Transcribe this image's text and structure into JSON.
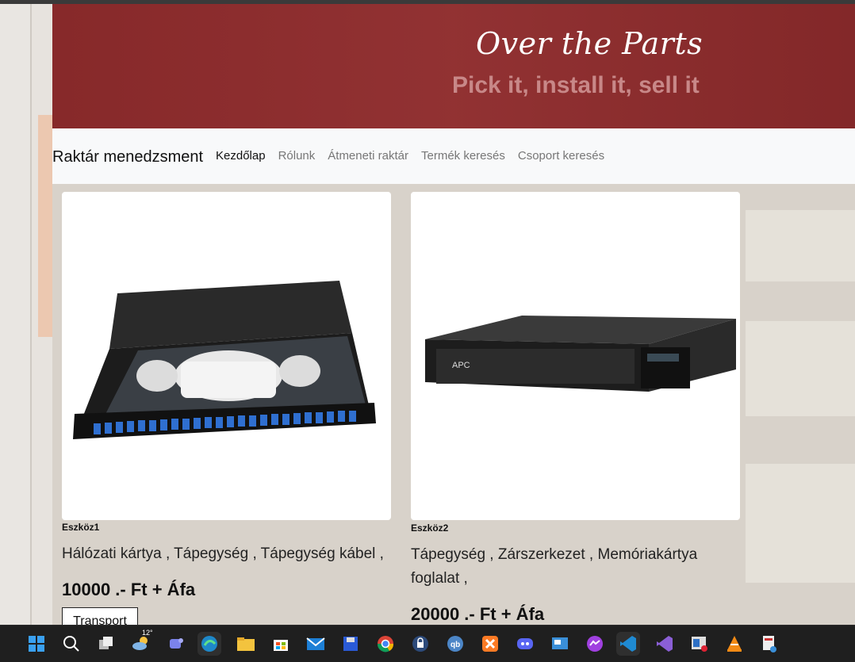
{
  "hero": {
    "title": "Over the Parts",
    "subtitle": "Pick it, install it, sell it"
  },
  "navbar": {
    "brand": "Raktár menedzsment",
    "links": [
      "Kezdőlap",
      "Rólunk",
      "Átmeneti raktár",
      "Termék keresés",
      "Csoport keresés"
    ]
  },
  "products": [
    {
      "name": "Eszköz1",
      "categories": "Hálózati kártya , Tápegység , Tápegység kábel ,",
      "price": "10000 .- Ft + Áfa",
      "button": "Transport",
      "image": "fiber-patch-panel"
    },
    {
      "name": "Eszköz2",
      "categories_line1": "Tápegység , Zárszerkezet , Memóriakártya",
      "categories_line2": "foglalat ,",
      "price": "20000 .- Ft + Áfa",
      "image": "apc-ups",
      "device_brand": "APC"
    }
  ],
  "taskbar": {
    "weather": "12°",
    "icons": [
      "windows-start-icon",
      "search-icon",
      "task-view-icon",
      "weather-icon",
      "teams-chat-icon",
      "edge-icon",
      "file-explorer-icon",
      "store-icon",
      "mail-icon",
      "save-icon",
      "chrome-icon",
      "vpn-icon",
      "qbittorrent-icon",
      "xampp-icon",
      "discord-icon",
      "control-panel-icon",
      "messenger-icon",
      "vscode-icon",
      "visual-studio-icon",
      "app-icon",
      "vlc-icon",
      "snipping-tool-icon"
    ]
  },
  "colors": {
    "hero_bg": "#8e2b2c",
    "navbar_bg": "#f8f9fa",
    "taskbar_bg": "#1f1f1f"
  }
}
